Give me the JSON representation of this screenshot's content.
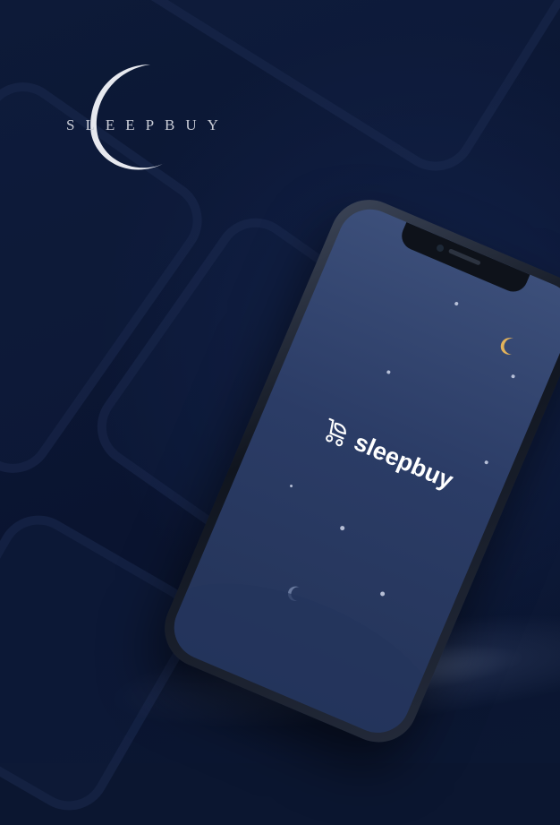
{
  "logo": {
    "text": "SLEEPBUY",
    "icon": "crescent-moon-icon"
  },
  "app_screen": {
    "brand_label": "sleepbuy",
    "icons": [
      "stroller-icon",
      "crescent-moon-icon"
    ]
  },
  "colors": {
    "background": "#0b1630",
    "screen_top": "#3c4f7a",
    "screen_bottom": "#243459",
    "moon_gold": "#e3b35a",
    "logo_text": "#c9ccd6"
  }
}
